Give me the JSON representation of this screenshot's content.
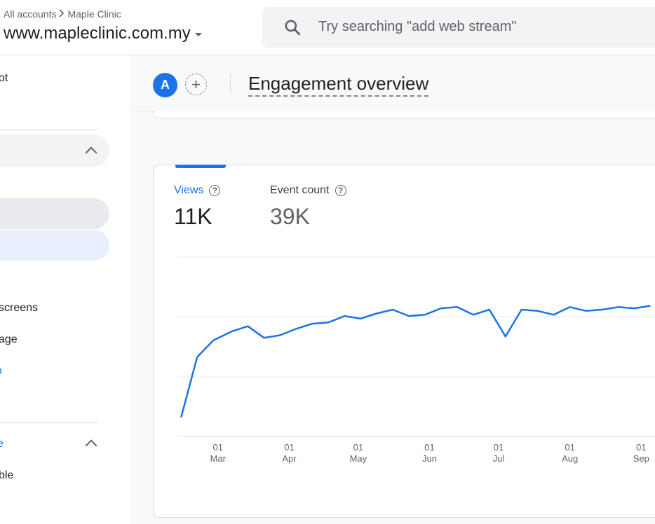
{
  "header": {
    "breadcrumb_account": "All accounts",
    "breadcrumb_property": "Maple Clinic",
    "property_name": "www.mapleclinic.com.my",
    "search_placeholder": "Try searching \"add web stream\""
  },
  "sidebar": {
    "items": [
      {
        "label": "ot"
      },
      {
        "label": "screens"
      },
      {
        "label": "age"
      },
      {
        "label": "n"
      },
      {
        "label": "e"
      },
      {
        "label": "ble"
      }
    ]
  },
  "toolbar": {
    "avatar_letter": "A",
    "add_comparison_symbol": "+",
    "page_title": "Engagement overview"
  },
  "metrics": [
    {
      "label": "Views",
      "value": "11K",
      "selected": true
    },
    {
      "label": "Event count",
      "value": "39K",
      "selected": false
    }
  ],
  "colors": {
    "accent": "#1a73e8",
    "line": "#1a73e8"
  },
  "chart_data": {
    "type": "line",
    "x": [
      "02-14",
      "02-21",
      "02-28",
      "03-07",
      "03-14",
      "03-21",
      "03-28",
      "04-04",
      "04-11",
      "04-18",
      "04-25",
      "05-02",
      "05-09",
      "05-16",
      "05-23",
      "05-30",
      "06-06",
      "06-13",
      "06-20",
      "06-27",
      "07-04",
      "07-11",
      "07-18",
      "07-25",
      "08-01",
      "08-08",
      "08-15",
      "08-22",
      "08-29",
      "09-05"
    ],
    "series": [
      {
        "values": [
          75,
          310,
          375,
          410,
          430,
          385,
          395,
          420,
          440,
          445,
          470,
          460,
          480,
          495,
          470,
          475,
          500,
          505,
          475,
          495,
          390,
          495,
          490,
          475,
          505,
          490,
          495,
          505,
          500,
          510
        ]
      }
    ],
    "x_tick_labels": [
      {
        "day": "01",
        "month": "Mar"
      },
      {
        "day": "01",
        "month": "Apr"
      },
      {
        "day": "01",
        "month": "May"
      },
      {
        "day": "01",
        "month": "Jun"
      },
      {
        "day": "01",
        "month": "Jul"
      },
      {
        "day": "01",
        "month": "Aug"
      },
      {
        "day": "01",
        "month": "Sep"
      }
    ],
    "grid": true
  }
}
